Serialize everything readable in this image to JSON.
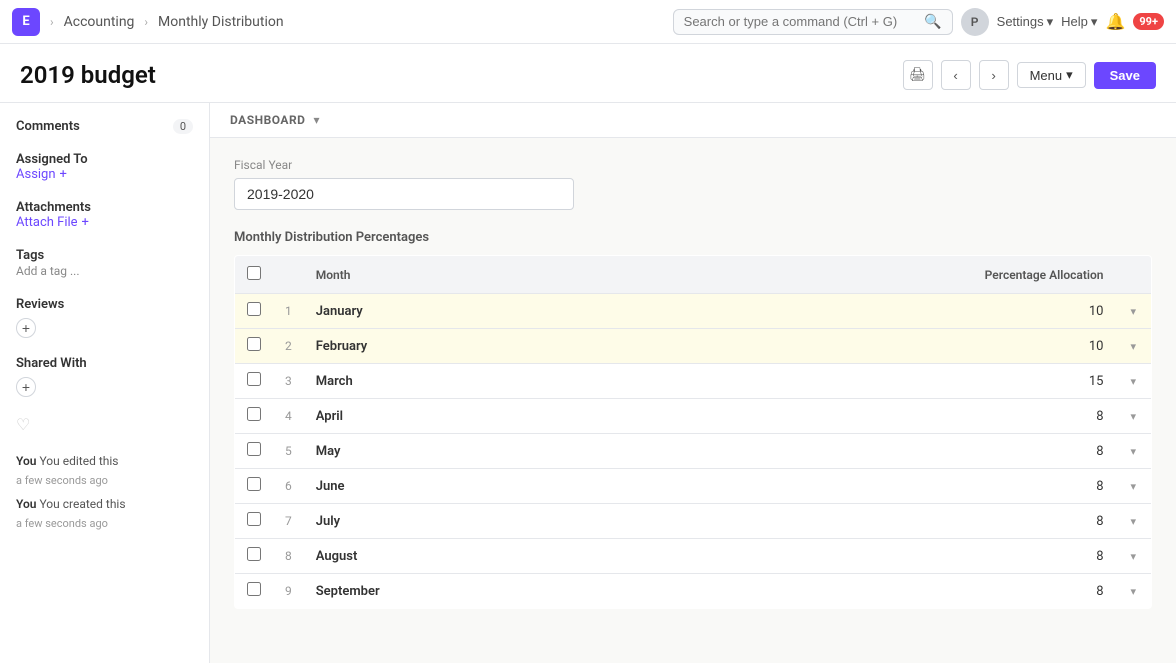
{
  "app": {
    "icon_label": "E",
    "breadcrumbs": [
      "Accounting",
      "Monthly Distribution"
    ],
    "search_placeholder": "Search or type a command (Ctrl + G)",
    "avatar_label": "P",
    "settings_label": "Settings",
    "help_label": "Help",
    "notification_count": "99+",
    "page_title": "2019 budget",
    "print_icon": "🖨",
    "back_icon": "‹",
    "forward_icon": "›",
    "menu_label": "Menu",
    "save_label": "Save"
  },
  "sidebar": {
    "comments_label": "Comments",
    "comments_count": "0",
    "assigned_to_label": "Assigned To",
    "assign_label": "Assign",
    "attachments_label": "Attachments",
    "attach_file_label": "Attach File",
    "tags_label": "Tags",
    "tags_placeholder": "Add a tag ...",
    "reviews_label": "Reviews",
    "shared_with_label": "Shared With",
    "activity_1": "You edited this",
    "activity_1_time": "a few seconds ago",
    "activity_2": "You created this",
    "activity_2_time": "a few seconds ago"
  },
  "dashboard": {
    "label": "DASHBOARD"
  },
  "form": {
    "fiscal_year_label": "Fiscal Year",
    "fiscal_year_value": "2019-2020",
    "table_title": "Monthly Distribution Percentages",
    "col_month": "Month",
    "col_percentage": "Percentage Allocation",
    "months": [
      {
        "num": 1,
        "name": "January",
        "pct": 10,
        "highlight": true
      },
      {
        "num": 2,
        "name": "February",
        "pct": 10,
        "highlight": true
      },
      {
        "num": 3,
        "name": "March",
        "pct": 15,
        "highlight": false
      },
      {
        "num": 4,
        "name": "April",
        "pct": 8,
        "highlight": false
      },
      {
        "num": 5,
        "name": "May",
        "pct": 8,
        "highlight": false
      },
      {
        "num": 6,
        "name": "June",
        "pct": 8,
        "highlight": false
      },
      {
        "num": 7,
        "name": "July",
        "pct": 8,
        "highlight": false
      },
      {
        "num": 8,
        "name": "August",
        "pct": 8,
        "highlight": false
      },
      {
        "num": 9,
        "name": "September",
        "pct": 8,
        "highlight": false
      }
    ]
  }
}
